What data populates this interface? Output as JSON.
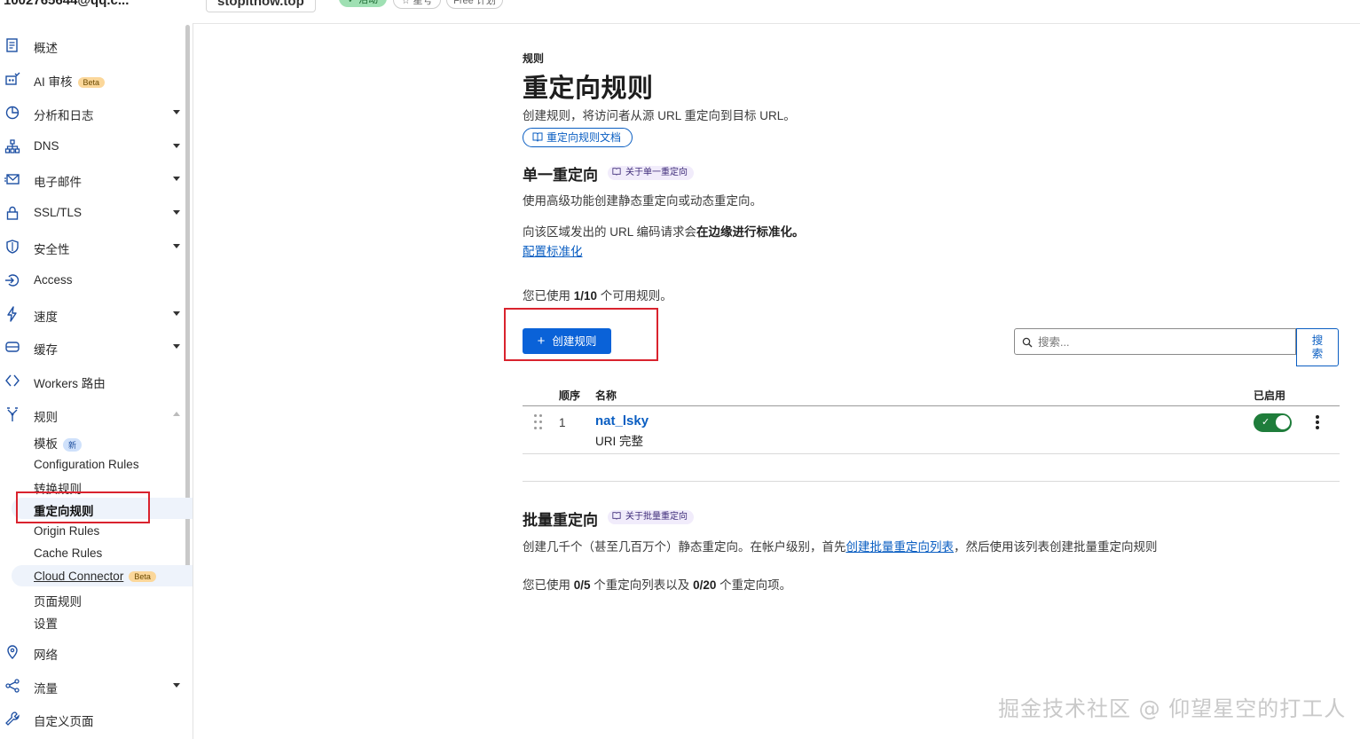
{
  "topbar": {
    "account": "1002765644@qq.c...",
    "zone": "stopitnow.top",
    "status": "✓ 活动",
    "star": "☆ 星号",
    "plan": "Free 计划"
  },
  "sidebar": {
    "items": [
      {
        "label": "概述",
        "icon": "document-icon"
      },
      {
        "label": "AI 审核",
        "icon": "ai-crawl-icon",
        "badge": "Beta"
      },
      {
        "label": "分析和日志",
        "icon": "chart-pie-icon"
      },
      {
        "label": "DNS",
        "icon": "network-tree-icon"
      },
      {
        "label": "电子邮件",
        "icon": "envelope-icon"
      },
      {
        "label": "SSL/TLS",
        "icon": "lock-icon"
      },
      {
        "label": "安全性",
        "icon": "shield-icon"
      },
      {
        "label": "Access",
        "icon": "access-icon"
      },
      {
        "label": "速度",
        "icon": "lightning-icon"
      },
      {
        "label": "缓存",
        "icon": "storage-icon"
      },
      {
        "label": "Workers 路由",
        "icon": "workers-icon"
      },
      {
        "label": "规则",
        "icon": "rules-fork-icon"
      }
    ],
    "rules_sub": [
      {
        "label": "模板",
        "badge": "新"
      },
      {
        "label": "Configuration Rules"
      },
      {
        "label": "转换规则"
      },
      {
        "label": "重定向规则"
      },
      {
        "label": "Origin Rules"
      },
      {
        "label": "Cache Rules"
      },
      {
        "label": "Cloud Connector",
        "badge": "Beta"
      },
      {
        "label": "页面规则"
      },
      {
        "label": "设置"
      }
    ],
    "bottom_items": [
      {
        "label": "网络",
        "icon": "location-pin-icon"
      },
      {
        "label": "流量",
        "icon": "traffic-icon"
      },
      {
        "label": "自定义页面",
        "icon": "wrench-icon"
      }
    ]
  },
  "main": {
    "eyebrow": "规则",
    "title": "重定向规则",
    "description": "创建规则，将访问者从源 URL 重定向到目标 URL。",
    "doc_link": "重定向规则文档",
    "single": {
      "heading": "单一重定向",
      "about": "关于单一重定向",
      "desc": "使用高级功能创建静态重定向或动态重定向。",
      "norm_prefix": "向该区域发出的 URL 编码请求会",
      "norm_bold": "在边缘进行标准化。",
      "norm_link": "配置标准化",
      "usage_prefix": "您已使用 ",
      "usage_value": "1/10",
      "usage_suffix": " 个可用规则。",
      "create_button": "创建规则",
      "search_placeholder": "搜索...",
      "search_button": "搜索"
    },
    "table": {
      "headers": {
        "order": "顺序",
        "name": "名称",
        "enabled": "已启用"
      },
      "rows": [
        {
          "order": "1",
          "name": "nat_lsky",
          "sub": "URI 完整",
          "enabled": true
        }
      ]
    },
    "bulk": {
      "heading": "批量重定向",
      "about": "关于批量重定向",
      "desc_prefix": "创建几千个（甚至几百万个）静态重定向。在帐户级别，首先",
      "desc_link": "创建批量重定向列表",
      "desc_suffix": "，然后使用该列表创建批量重定向规则",
      "usage_a_prefix": "您已使用 ",
      "usage_a_value": "0/5",
      "usage_b_prefix": " 个重定向列表以及 ",
      "usage_b_value": "0/20",
      "usage_b_suffix": " 个重定向项。"
    }
  },
  "watermark": "掘金技术社区 @ 仰望星空的打工人",
  "colors": {
    "accent": "#0a62d8",
    "toggle_on": "#1f7d3b",
    "highlight": "#d9232e"
  }
}
